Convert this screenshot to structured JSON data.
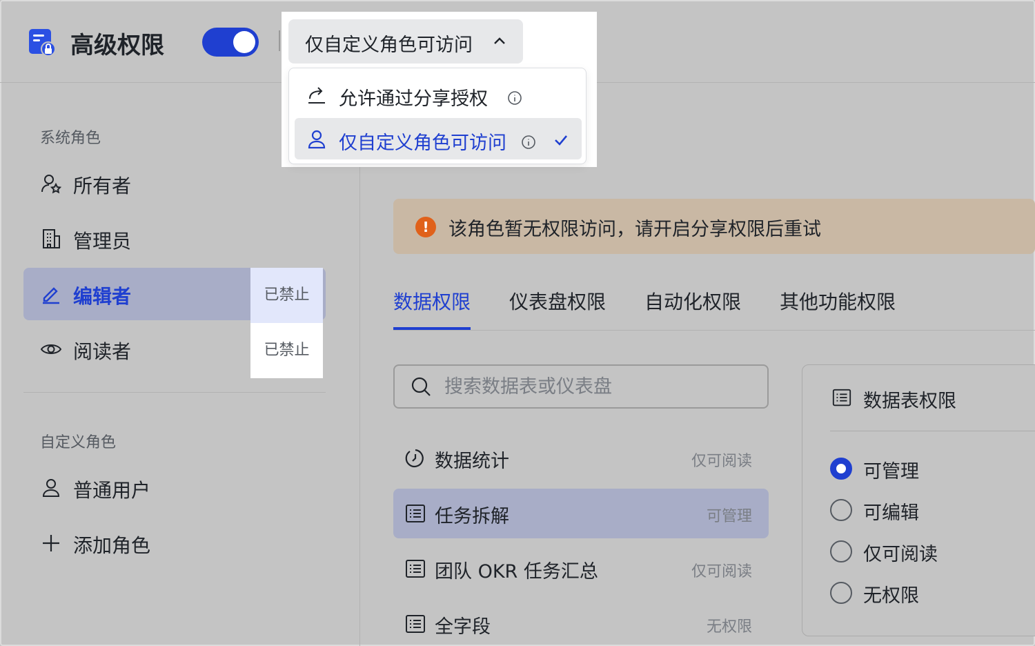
{
  "header": {
    "title": "高级权限",
    "toggle_on": true,
    "access_select_value": "仅自定义角色可访问"
  },
  "dropdown": {
    "options": [
      {
        "label": "允许通过分享授权",
        "selected": false
      },
      {
        "label": "仅自定义角色可访问",
        "selected": true
      }
    ]
  },
  "sidebar": {
    "system_roles_label": "系统角色",
    "system_roles": [
      {
        "label": "所有者",
        "icon": "owner-icon"
      },
      {
        "label": "管理员",
        "icon": "building-icon"
      },
      {
        "label": "编辑者",
        "icon": "pen-icon",
        "badge": "已禁止"
      },
      {
        "label": "阅读者",
        "icon": "eye-icon",
        "badge": "已禁止"
      }
    ],
    "custom_roles_label": "自定义角色",
    "custom_roles": [
      {
        "label": "普通用户",
        "icon": "user-icon"
      },
      {
        "label": "添加角色",
        "icon": "plus-icon"
      }
    ]
  },
  "alert": {
    "message": "该角色暂无权限访问，请开启分享权限后重试",
    "icon": "warning-icon",
    "icon_text": "!"
  },
  "tabs": [
    "数据权限",
    "仪表盘权限",
    "自动化权限",
    "其他功能权限"
  ],
  "search": {
    "placeholder": "搜索数据表或仪表盘",
    "value": ""
  },
  "tables": [
    {
      "name": "数据统计",
      "permission": "仅可阅读",
      "icon": "dashboard-icon"
    },
    {
      "name": "任务拆解",
      "permission": "可管理",
      "icon": "table-icon"
    },
    {
      "name": "团队 OKR 任务汇总",
      "permission": "仅可阅读",
      "icon": "table-icon"
    },
    {
      "name": "全字段",
      "permission": "无权限",
      "icon": "table-icon"
    }
  ],
  "panel": {
    "title": "数据表权限",
    "options": [
      "可管理",
      "可编辑",
      "仅可阅读",
      "无权限"
    ],
    "selected": "可管理"
  },
  "colors": {
    "accent": "#1f3fd0",
    "warning": "#e0611a"
  }
}
